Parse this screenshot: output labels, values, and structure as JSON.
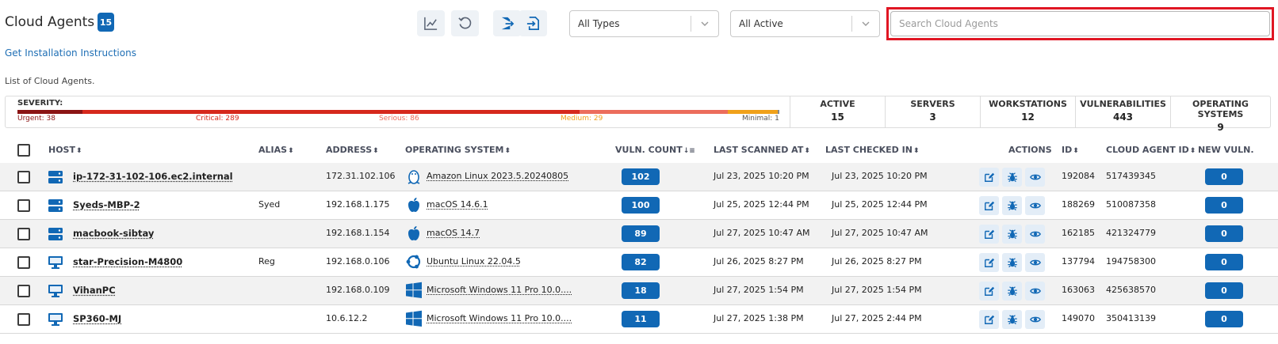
{
  "header": {
    "title": "Cloud Agents",
    "count": "15",
    "install_link": "Get Installation Instructions",
    "subtitle": "List of Cloud Agents."
  },
  "toolbar": {
    "buttons": [
      "chart-icon",
      "refresh-icon",
      "export-icon",
      "import-icon"
    ],
    "type_filter": "All Types",
    "status_filter": "All Active",
    "search_placeholder": "Search Cloud Agents"
  },
  "severity": {
    "title": "SEVERITY:",
    "segments": [
      {
        "label": "Urgent: 38",
        "value": 38,
        "color": "#8b1414"
      },
      {
        "label": "Critical: 289",
        "value": 289,
        "color": "#d6281c"
      },
      {
        "label": "Serious: 86",
        "value": 86,
        "color": "#ec6d5c"
      },
      {
        "label": "Medium: 29",
        "value": 29,
        "color": "#f0a11a"
      },
      {
        "label": "Minimal: 1",
        "value": 1,
        "color": "#8a8a8a"
      }
    ]
  },
  "stats": [
    {
      "label": "ACTIVE",
      "value": "15"
    },
    {
      "label": "SERVERS",
      "value": "3"
    },
    {
      "label": "WORKSTATIONS",
      "value": "12"
    },
    {
      "label": "VULNERABILITIES",
      "value": "443"
    },
    {
      "label": "OPERATING SYSTEMS",
      "value": "9"
    }
  ],
  "table": {
    "columns": {
      "host": "HOST",
      "alias": "ALIAS",
      "address": "ADDRESS",
      "os": "OPERATING SYSTEM",
      "vuln_count": "VULN. COUNT",
      "last_scanned": "LAST SCANNED AT",
      "last_checked": "LAST CHECKED IN",
      "actions": "ACTIONS",
      "id": "ID",
      "agent_id": "CLOUD AGENT ID",
      "new_vuln": "NEW VULN."
    },
    "rows": [
      {
        "host": "ip-172-31-102-106.ec2.internal",
        "host_type": "server-icon",
        "alias": "",
        "address": "172.31.102.106",
        "os": "Amazon Linux 2023.5.20240805",
        "os_icon": "linux-icon",
        "vuln": "102",
        "scanned": "Jul 23, 2025 10:20 PM",
        "checked": "Jul 23, 2025 10:20 PM",
        "id": "192084",
        "agent_id": "517439345",
        "new_vuln": "0"
      },
      {
        "host": "Syeds-MBP-2",
        "host_type": "server-icon",
        "alias": "Syed",
        "address": "192.168.1.175",
        "os": "macOS 14.6.1",
        "os_icon": "apple-icon",
        "vuln": "100",
        "scanned": "Jul 25, 2025 12:44 PM",
        "checked": "Jul 25, 2025 12:44 PM",
        "id": "188269",
        "agent_id": "510087358",
        "new_vuln": "0"
      },
      {
        "host": "macbook-sibtay",
        "host_type": "server-icon",
        "alias": "",
        "address": "192.168.1.154",
        "os": "macOS 14.7",
        "os_icon": "apple-icon",
        "vuln": "89",
        "scanned": "Jul 27, 2025 10:47 AM",
        "checked": "Jul 27, 2025 10:47 AM",
        "id": "162185",
        "agent_id": "421324779",
        "new_vuln": "0"
      },
      {
        "host": "star-Precision-M4800",
        "host_type": "monitor-icon",
        "alias": "Reg",
        "address": "192.168.0.106",
        "os": "Ubuntu Linux 22.04.5",
        "os_icon": "ubuntu-icon",
        "vuln": "82",
        "scanned": "Jul 26, 2025 8:27 PM",
        "checked": "Jul 26, 2025 8:27 PM",
        "id": "137794",
        "agent_id": "194758300",
        "new_vuln": "0"
      },
      {
        "host": "VihanPC",
        "host_type": "monitor-icon",
        "alias": "",
        "address": "192.168.0.109",
        "os": "Microsoft Windows 11 Pro 10.0....",
        "os_icon": "windows-icon",
        "vuln": "18",
        "scanned": "Jul 27, 2025 1:54 PM",
        "checked": "Jul 27, 2025 1:54 PM",
        "id": "163063",
        "agent_id": "425638570",
        "new_vuln": "0"
      },
      {
        "host": "SP360-MJ",
        "host_type": "monitor-icon",
        "alias": "",
        "address": "10.6.12.2",
        "os": "Microsoft Windows 11 Pro 10.0....",
        "os_icon": "windows-icon",
        "vuln": "11",
        "scanned": "Jul 27, 2025 1:38 PM",
        "checked": "Jul 27, 2025 2:44 PM",
        "id": "149070",
        "agent_id": "350413139",
        "new_vuln": "0"
      }
    ]
  },
  "colors": {
    "accent": "#1168b5",
    "highlight_border": "#e01623",
    "link": "#1f6fb5"
  }
}
